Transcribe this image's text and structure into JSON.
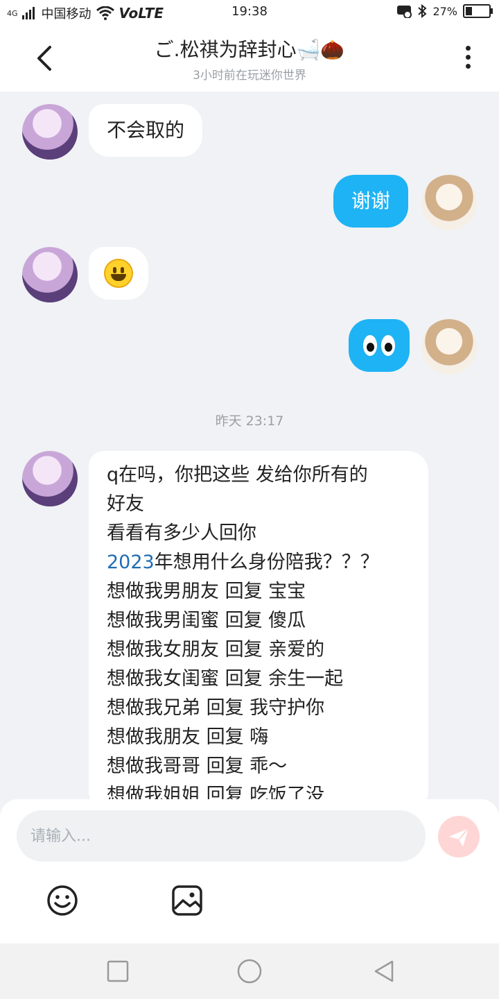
{
  "status": {
    "network": "4G",
    "carrier": "中国移动",
    "volte": "VoLTE",
    "time": "19:38",
    "battery": "27%"
  },
  "header": {
    "title": "ご.松祺为辞封心🛁🌰",
    "subtitle": "3小时前在玩迷你世界"
  },
  "messages": [
    {
      "side": "left",
      "text": "不会取的"
    },
    {
      "side": "right",
      "text": "谢谢"
    },
    {
      "side": "left",
      "emoji": "smile"
    },
    {
      "side": "right",
      "emoji": "eyes"
    }
  ],
  "timestamp": "昨天 23:17",
  "long_message": {
    "lines": [
      "q在吗，你把这些 发给你所有的",
      "好友",
      "看看有多少人回你",
      "年想用什么身份陪我？？？",
      "想做我男朋友 回复 宝宝",
      "想做我男闺蜜 回复 傻瓜",
      "想做我女朋友 回复 亲爱的",
      "想做我女闺蜜 回复 余生一起",
      "想做我兄弟 回复 我守护你",
      "想做我朋友 回复 嗨",
      "想做我哥哥 回复 乖～",
      "想做我姐姐 回复 吃饭了没"
    ],
    "year": "2023"
  },
  "composer": {
    "placeholder": "请输入..."
  },
  "colors": {
    "accent": "#1eb3f4",
    "background": "#f0f2f5",
    "send_button": "#ffd6d6"
  }
}
